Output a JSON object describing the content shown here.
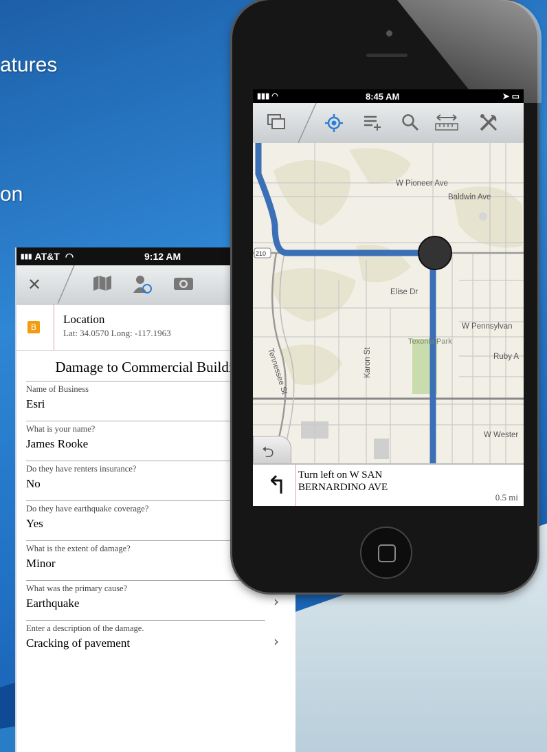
{
  "slide": {
    "text_top": "atures",
    "text_mid": "on"
  },
  "form_phone": {
    "status": {
      "carrier": "AT&T",
      "time": "9:12 AM"
    },
    "toolbar": {
      "close_icon": "close-icon",
      "icons": [
        "map-icon",
        "person-location-icon",
        "camera-icon"
      ]
    },
    "location": {
      "badge": "B",
      "title": "Location",
      "coords": "Lat: 34.0570 Long: -117.1963"
    },
    "form_title": "Damage to Commercial Buildings:",
    "questions": [
      {
        "label": "Name of Business",
        "value": "Esri",
        "chevron": false
      },
      {
        "label": "What is your name?",
        "value": "James Rooke",
        "chevron": false
      },
      {
        "label": "Do they have renters insurance?",
        "value": "No",
        "chevron": false
      },
      {
        "label": "Do they have earthquake coverage?",
        "value": "Yes",
        "chevron": false
      },
      {
        "label": "What is the extent of damage?",
        "value": "Minor",
        "chevron": true
      },
      {
        "label": "What was the primary cause?",
        "value": "Earthquake",
        "chevron": true
      },
      {
        "label": "Enter a description of the damage.",
        "value": "Cracking of pavement",
        "chevron": true
      }
    ]
  },
  "map_phone": {
    "status": {
      "time": "8:45 AM"
    },
    "toolbar_icons": [
      "layers-icon",
      "locate-icon",
      "add-feature-icon",
      "search-icon",
      "measure-icon",
      "tools-icon"
    ],
    "streets": {
      "pioneer": "W Pioneer Ave",
      "baldwin": "Baldwin Ave",
      "elise": "Elise Dr",
      "pennsylvania": "W Pennsylvan",
      "ruby": "Ruby A",
      "texonia": "Texonia Park",
      "karon": "Karon St",
      "tennessee": "Tennessee St",
      "western": "W Wester",
      "hwy": "210"
    },
    "directions": {
      "instruction": "Turn left on W SAN BERNARDINO AVE",
      "distance": "0.5 mi"
    }
  }
}
